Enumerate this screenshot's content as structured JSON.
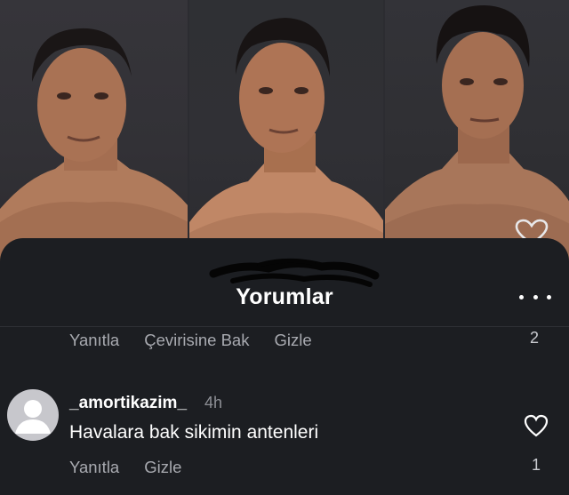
{
  "sheet": {
    "title": "Yorumlar"
  },
  "first_comment_actions": {
    "reply": "Yanıtla",
    "translate": "Çevirisine Bak",
    "hide": "Gizle",
    "like_count": "2"
  },
  "comment": {
    "username": "_amortikazim_",
    "timestamp": "4h",
    "text": "Havalara bak sikimin antenleri",
    "reply": "Yanıtla",
    "hide": "Gizle",
    "like_count": "1"
  },
  "icons": {
    "more": "more-horizontal-icon",
    "like": "heart-outline-icon",
    "avatar": "default-avatar-icon"
  },
  "colors": {
    "background": "#1c1e22",
    "text_primary": "#ffffff",
    "text_secondary": "#a8aab0"
  }
}
